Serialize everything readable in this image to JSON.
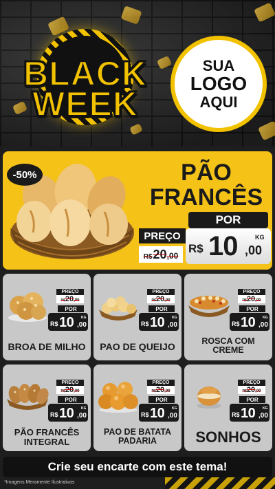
{
  "colors": {
    "accent_yellow": "#f5c218",
    "dark": "#1a1a1a",
    "card_gray": "#c8c8c8",
    "strike_red": "#cc0000"
  },
  "header": {
    "badge_line1": "BLACK",
    "badge_line2": "WEEK",
    "logo_line1": "SUA",
    "logo_line2": "LOGO",
    "logo_line3": "AQUI"
  },
  "hero": {
    "discount": "-50%",
    "title_line1": "PÃO",
    "title_line2": "FRANCÊS",
    "preco_label": "PREÇO",
    "old_currency": "R$",
    "old_int": "20",
    "old_cents": ",00",
    "por_label": "POR",
    "new_currency": "R$",
    "new_int": "10",
    "new_cents": ",00",
    "unit": "KG",
    "image_icon": "bread-basket-icon"
  },
  "products": [
    {
      "name_line1": "BROA DE MILHO",
      "name_line2": "",
      "icon": "corn-bread-icon",
      "preco_label": "PREÇO",
      "old_currency": "R$",
      "old_int": "20",
      "old_cents": ",00",
      "por_label": "POR",
      "new_currency": "R$",
      "new_int": "10",
      "new_cents": ",00",
      "unit": "KG"
    },
    {
      "name_line1": "PAO DE QUEIJO",
      "name_line2": "",
      "icon": "cheese-bread-icon",
      "preco_label": "PREÇO",
      "old_currency": "R$",
      "old_int": "20",
      "old_cents": ",00",
      "por_label": "POR",
      "new_currency": "R$",
      "new_int": "10",
      "new_cents": ",00",
      "unit": "KG"
    },
    {
      "name_line1": "ROSCA COM",
      "name_line2": "CREME",
      "icon": "sweet-roll-icon",
      "preco_label": "PREÇO",
      "old_currency": "R$",
      "old_int": "20",
      "old_cents": ",00",
      "por_label": "POR",
      "new_currency": "R$",
      "new_int": "10",
      "new_cents": ",00",
      "unit": "KG"
    },
    {
      "name_line1": "PÃO FRANCÊS",
      "name_line2": "INTEGRAL",
      "icon": "wholegrain-bread-icon",
      "preco_label": "PREÇO",
      "old_currency": "R$",
      "old_int": "20",
      "old_cents": ",00",
      "por_label": "POR",
      "new_currency": "R$",
      "new_int": "10",
      "new_cents": ",00",
      "unit": "KG"
    },
    {
      "name_line1": "PAO DE BATATA",
      "name_line2": "PADARIA",
      "icon": "potato-bun-icon",
      "preco_label": "PREÇO",
      "old_currency": "R$",
      "old_int": "20",
      "old_cents": ",00",
      "por_label": "POR",
      "new_currency": "R$",
      "new_int": "10",
      "new_cents": ",00",
      "unit": "KG"
    },
    {
      "name_line1": "SONHOS",
      "name_line2": "",
      "icon": "donut-icon",
      "preco_label": "PREÇO",
      "old_currency": "R$",
      "old_int": "20",
      "old_cents": ",00",
      "por_label": "POR",
      "new_currency": "R$",
      "new_int": "10",
      "new_cents": ",00",
      "unit": "KG"
    }
  ],
  "footer": {
    "cta": "Crie seu encarte com este tema!",
    "disclaimer": "*Imagens Meramente Ilustrativas"
  }
}
